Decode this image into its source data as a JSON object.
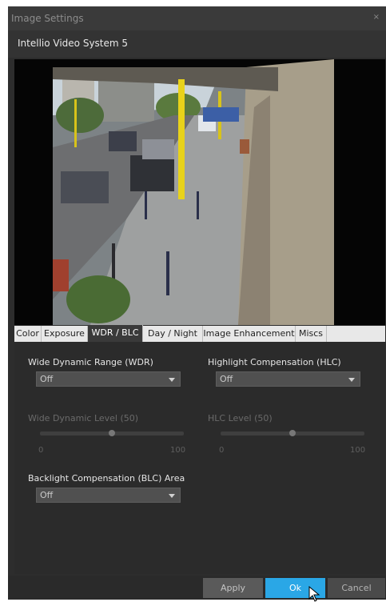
{
  "window": {
    "title": "Image Settings",
    "close_glyph": "×"
  },
  "device": {
    "name": "Intellio Video System 5"
  },
  "preview": {
    "description_icon": "camera-feed-street"
  },
  "tabs": [
    "Color",
    "Exposure",
    "WDR / BLC",
    "Day / Night",
    "Image Enhancement",
    "Miscs"
  ],
  "active_tab": "WDR / BLC",
  "wdr": {
    "label": "Wide Dynamic Range (WDR)",
    "value": "Off",
    "level_label": "Wide Dynamic Level (50)",
    "level": 50,
    "min": "0",
    "max": "100"
  },
  "hlc": {
    "label": "Highlight Compensation (HLC)",
    "value": "Off",
    "level_label": "HLC Level (50)",
    "level": 50,
    "min": "0",
    "max": "100"
  },
  "blc": {
    "label": "Backlight Compensation (BLC) Area",
    "value": "Off"
  },
  "buttons": {
    "apply": "Apply",
    "ok": "Ok",
    "cancel": "Cancel"
  },
  "colors": {
    "accent": "#2aa7e6",
    "panel": "#2b2b2b",
    "tab_bar": "#e8e8e8"
  }
}
